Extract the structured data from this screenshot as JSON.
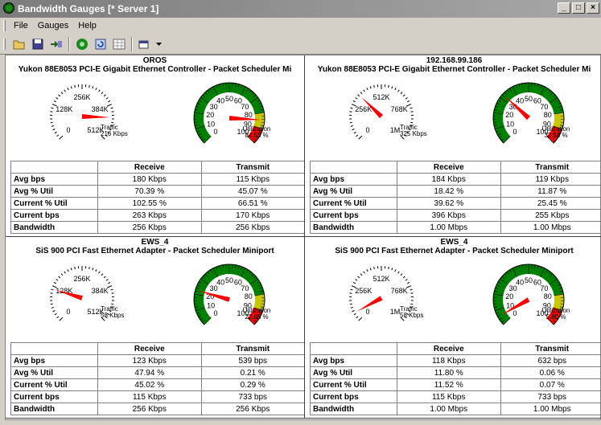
{
  "window": {
    "title": "Bandwidth Gauges [* Server 1]",
    "controls": [
      "_",
      "□",
      "×"
    ]
  },
  "menu": [
    "File",
    "Gauges",
    "Help"
  ],
  "toolbar": {
    "icons": [
      "open-folder-icon",
      "save-icon",
      "connect-icon",
      "start-icon",
      "refresh-icon",
      "grid-icon",
      "options-icon",
      "dropdown-arrow-icon"
    ]
  },
  "colors": {
    "needle": "#ff0000",
    "good": "#008000",
    "warn": "#c8c800",
    "bad": "#ff0000"
  },
  "panels": [
    {
      "host": "OROS",
      "adapter": "Yukon 88E8053 PCI-E Gigabit Ethernet Controller - Packet Scheduler Mi",
      "traffic": {
        "label": "Traffic",
        "value": "216 Kbps",
        "ticks": [
          "0",
          "128K",
          "256K",
          "384K",
          "512K"
        ],
        "needle_fraction": 0.84
      },
      "utilization": {
        "label": "Utilization",
        "value": "84.53 %",
        "percent": 84.53
      },
      "headers": [
        "Receive",
        "Transmit"
      ],
      "rows": [
        {
          "label": "Avg bps",
          "receive": "180 Kbps",
          "transmit": "115 Kbps"
        },
        {
          "label": "Avg % Util",
          "receive": "70.39 %",
          "transmit": "45.07 %"
        },
        {
          "label": "Current % Util",
          "receive": "102.55 %",
          "transmit": "66.51 %"
        },
        {
          "label": "Current bps",
          "receive": "263 Kbps",
          "transmit": "170 Kbps"
        },
        {
          "label": "Bandwidth",
          "receive": "256 Kbps",
          "transmit": "256 Kbps"
        }
      ]
    },
    {
      "host": "192.168.99.186",
      "adapter": "Yukon 88E8053 PCI-E Gigabit Ethernet Controller - Packet Scheduler Mi",
      "traffic": {
        "label": "Traffic",
        "value": "325 Kbps",
        "ticks": [
          "0",
          "256K",
          "512K",
          "768K",
          "1M"
        ],
        "needle_fraction": 0.33
      },
      "utilization": {
        "label": "Utilization",
        "value": "32.54 %",
        "percent": 32.54
      },
      "headers": [
        "Receive",
        "Transmit"
      ],
      "rows": [
        {
          "label": "Avg bps",
          "receive": "184 Kbps",
          "transmit": "119 Kbps"
        },
        {
          "label": "Avg % Util",
          "receive": "18.42 %",
          "transmit": "11.87 %"
        },
        {
          "label": "Current % Util",
          "receive": "39.62 %",
          "transmit": "25.45 %"
        },
        {
          "label": "Current bps",
          "receive": "396 Kbps",
          "transmit": "255 Kbps"
        },
        {
          "label": "Bandwidth",
          "receive": "1.00 Mbps",
          "transmit": "1.00 Mbps"
        }
      ]
    },
    {
      "host": "EWS_4",
      "adapter": "SiS 900 PCI Fast Ethernet Adapter - Packet Scheduler Miniport",
      "traffic": {
        "label": "Traffic",
        "value": "58 Kbps",
        "ticks": [
          "0",
          "128K",
          "256K",
          "384K",
          "512K"
        ],
        "needle_fraction": 0.23
      },
      "utilization": {
        "label": "Utilization",
        "value": "22.65 %",
        "percent": 22.65
      },
      "headers": [
        "Receive",
        "Transmit"
      ],
      "rows": [
        {
          "label": "Avg bps",
          "receive": "123 Kbps",
          "transmit": "539 bps"
        },
        {
          "label": "Avg % Util",
          "receive": "47.94 %",
          "transmit": "0.21 %"
        },
        {
          "label": "Current % Util",
          "receive": "45.02 %",
          "transmit": "0.29 %"
        },
        {
          "label": "Current bps",
          "receive": "115 Kbps",
          "transmit": "733 bps"
        },
        {
          "label": "Bandwidth",
          "receive": "256 Kbps",
          "transmit": "256 Kbps"
        }
      ]
    },
    {
      "host": "EWS_4",
      "adapter": "SiS 900 PCI Fast Ethernet Adapter - Packet Scheduler Miniport",
      "traffic": {
        "label": "Traffic",
        "value": "58 Kbps",
        "ticks": [
          "0",
          "256K",
          "512K",
          "768K",
          "1M"
        ],
        "needle_fraction": 0.06
      },
      "utilization": {
        "label": "Utilization",
        "value": "5.80 %",
        "percent": 5.8
      },
      "headers": [
        "Receive",
        "Transmit"
      ],
      "rows": [
        {
          "label": "Avg bps",
          "receive": "118 Kbps",
          "transmit": "632 bps"
        },
        {
          "label": "Avg % Util",
          "receive": "11.80 %",
          "transmit": "0.06 %"
        },
        {
          "label": "Current % Util",
          "receive": "11.52 %",
          "transmit": "0.07 %"
        },
        {
          "label": "Current bps",
          "receive": "115 Kbps",
          "transmit": "733 bps"
        },
        {
          "label": "Bandwidth",
          "receive": "1.00 Mbps",
          "transmit": "1.00 Mbps"
        }
      ]
    }
  ],
  "util_ticks": [
    "0",
    "10",
    "20",
    "30",
    "40",
    "50",
    "60",
    "70",
    "80",
    "90",
    "100"
  ]
}
